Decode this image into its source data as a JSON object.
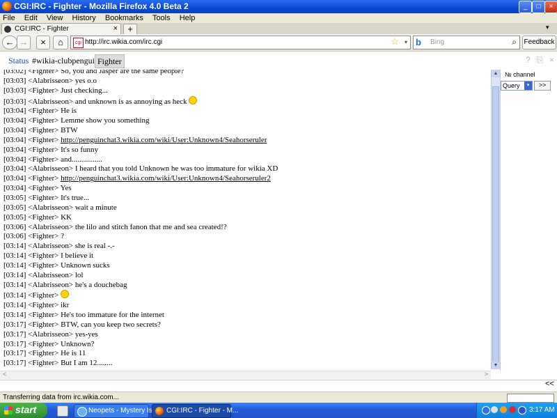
{
  "window": {
    "title": "CGI:IRC - Fighter - Mozilla Firefox 4.0 Beta 2",
    "min": "_",
    "max": "□",
    "close": "×"
  },
  "menu": [
    "File",
    "Edit",
    "View",
    "History",
    "Bookmarks",
    "Tools",
    "Help"
  ],
  "tabs": {
    "label": "CGI:IRC - Fighter",
    "close": "×",
    "new": "+",
    "list": "▾"
  },
  "nav": {
    "back": "←",
    "forward": "→",
    "stop": "×",
    "home": "⌂",
    "url": "http://irc.wikia.com/irc.cgi",
    "favicon": "cgi",
    "star": "☆",
    "url_dropdown": "▾",
    "search_logo": "b",
    "search_placeholder": "Bing",
    "search_icon": "⌕",
    "feedback": "Feedback ▾"
  },
  "irc": {
    "tabs": [
      "Status",
      "#wikia-clubpenguin",
      "Fighter"
    ],
    "controls": [
      "?",
      "⎘",
      "×"
    ],
    "nicklist_header": "№ channel",
    "query_select": "Query",
    "query_arrow": "▾",
    "query_go": ">>",
    "send": "<<",
    "hscroll_left": "<",
    "hscroll_right": ">",
    "vscroll_up": "▲",
    "vscroll_down": "▼",
    "messages": [
      {
        "time": "[03:02]",
        "nick": "<Fighter>",
        "text": "So, you and Jasper are the same people?"
      },
      {
        "time": "[03:03]",
        "nick": "<Alabrisseon>",
        "text": "yes o.o"
      },
      {
        "time": "[03:03]",
        "nick": "<Fighter>",
        "text": "Just checking..."
      },
      {
        "time": "[03:03]",
        "nick": "<Alabrisseon>",
        "text": "and unknown is as annoying as heck",
        "emoticon": "wink"
      },
      {
        "time": "[03:04]",
        "nick": "<Fighter>",
        "text": "He is"
      },
      {
        "time": "[03:04]",
        "nick": "<Fighter>",
        "text": "Lemme show you something"
      },
      {
        "time": "[03:04]",
        "nick": "<Fighter>",
        "text": "BTW"
      },
      {
        "time": "[03:04]",
        "nick": "<Fighter>",
        "text": "",
        "link": "http://penguinchat3.wikia.com/wiki/User:Unknown4/Seahorseruler"
      },
      {
        "time": "[03:04]",
        "nick": "<Fighter>",
        "text": "It's so funny"
      },
      {
        "time": "[03:04]",
        "nick": "<Fighter>",
        "text": "and................"
      },
      {
        "time": "[03:04]",
        "nick": "<Alabrisseon>",
        "text": "I heard that you told Unknown he was too immature for wikia XD"
      },
      {
        "time": "[03:04]",
        "nick": "<Fighter>",
        "text": "",
        "link": "http://penguinchat3.wikia.com/wiki/User:Unknown4/Seahorseruler2"
      },
      {
        "time": "[03:04]",
        "nick": "<Fighter>",
        "text": "Yes"
      },
      {
        "time": "[03:05]",
        "nick": "<Fighter>",
        "text": "It's true..."
      },
      {
        "time": "[03:05]",
        "nick": "<Alabrisseon>",
        "text": "wait a minute"
      },
      {
        "time": "[03:05]",
        "nick": "<Fighter>",
        "text": "KK"
      },
      {
        "time": "[03:06]",
        "nick": "<Alabrisseon>",
        "text": "the lilo and stitch fanon that me and sea created!?"
      },
      {
        "time": "[03:06]",
        "nick": "<Fighter>",
        "text": "?"
      },
      {
        "time": "[03:14]",
        "nick": "<Alabrisseon>",
        "text": "she is real -.-"
      },
      {
        "time": "[03:14]",
        "nick": "<Fighter>",
        "text": "I believe it"
      },
      {
        "time": "[03:14]",
        "nick": "<Fighter>",
        "text": "Unknown sucks"
      },
      {
        "time": "[03:14]",
        "nick": "<Alabrisseon>",
        "text": "lol"
      },
      {
        "time": "[03:14]",
        "nick": "<Alabrisseon>",
        "text": "he's a douchebag"
      },
      {
        "time": "[03:14]",
        "nick": "<Fighter>",
        "text": "",
        "emoticon": "smile"
      },
      {
        "time": "[03:14]",
        "nick": "<Fighter>",
        "text": "ikr"
      },
      {
        "time": "[03:14]",
        "nick": "<Fighter>",
        "text": "He's too immature for the internet"
      },
      {
        "time": "[03:17]",
        "nick": "<Fighter>",
        "text": "BTW, can you keep two secrets?"
      },
      {
        "time": "[03:17]",
        "nick": "<Alabrisseon>",
        "text": "yes-yes"
      },
      {
        "time": "[03:17]",
        "nick": "<Fighter>",
        "text": "Unknown?"
      },
      {
        "time": "[03:17]",
        "nick": "<Fighter>",
        "text": "He is 11"
      },
      {
        "time": "[03:17]",
        "nick": "<Fighter>",
        "text": "But I am 12........"
      }
    ]
  },
  "status_text": "Transferring data from irc.wikia.com...",
  "taskbar": {
    "start": "start",
    "tasks": [
      "Neopets - Mystery Isl...",
      "CGI:IRC - Fighter - M..."
    ],
    "clock": "3:17 AM"
  }
}
